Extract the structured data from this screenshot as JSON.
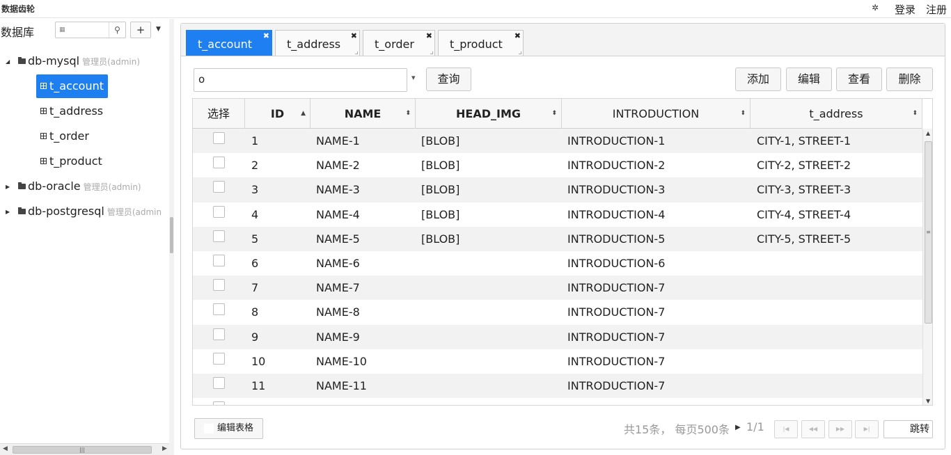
{
  "app": {
    "title": "数据齿轮",
    "settings_icon": "gear-icon",
    "settings_glyph": "✲",
    "login": "登录",
    "register": "注册"
  },
  "sidebar": {
    "title": "数据库",
    "search_placeholder": "",
    "add_label": "+",
    "databases": [
      {
        "name": "db-mysql",
        "role": "管理员(admin)",
        "expanded": true,
        "tables": [
          "t_account",
          "t_address",
          "t_order",
          "t_product"
        ],
        "selected": "t_account"
      },
      {
        "name": "db-oracle",
        "role": "管理员(admin)",
        "expanded": false
      },
      {
        "name": "db-postgresql",
        "role": "管理员(admin",
        "expanded": false
      }
    ]
  },
  "tabs": [
    {
      "label": "t_account",
      "active": true
    },
    {
      "label": "t_address",
      "active": false
    },
    {
      "label": "t_order",
      "active": false
    },
    {
      "label": "t_product",
      "active": false
    }
  ],
  "toolbar": {
    "query_value": "o",
    "query_button": "查询",
    "add_button": "添加",
    "edit_button": "编辑",
    "view_button": "查看",
    "delete_button": "删除"
  },
  "grid": {
    "columns": [
      "选择",
      "ID",
      "NAME",
      "HEAD_IMG",
      "INTRODUCTION",
      "t_address"
    ],
    "sorted_column": "ID",
    "rows": [
      {
        "id": "1",
        "name": "NAME-1",
        "head_img": "[BLOB]",
        "intro": "INTRODUCTION-1",
        "address": "CITY-1, STREET-1"
      },
      {
        "id": "2",
        "name": "NAME-2",
        "head_img": "[BLOB]",
        "intro": "INTRODUCTION-2",
        "address": "CITY-2, STREET-2"
      },
      {
        "id": "3",
        "name": "NAME-3",
        "head_img": "[BLOB]",
        "intro": "INTRODUCTION-3",
        "address": "CITY-3, STREET-3"
      },
      {
        "id": "4",
        "name": "NAME-4",
        "head_img": "[BLOB]",
        "intro": "INTRODUCTION-4",
        "address": "CITY-4, STREET-4"
      },
      {
        "id": "5",
        "name": "NAME-5",
        "head_img": "[BLOB]",
        "intro": "INTRODUCTION-5",
        "address": "CITY-5, STREET-5"
      },
      {
        "id": "6",
        "name": "NAME-6",
        "head_img": "",
        "intro": "INTRODUCTION-6",
        "address": ""
      },
      {
        "id": "7",
        "name": "NAME-7",
        "head_img": "",
        "intro": "INTRODUCTION-7",
        "address": ""
      },
      {
        "id": "8",
        "name": "NAME-8",
        "head_img": "",
        "intro": "INTRODUCTION-7",
        "address": ""
      },
      {
        "id": "9",
        "name": "NAME-9",
        "head_img": "",
        "intro": "INTRODUCTION-7",
        "address": ""
      },
      {
        "id": "10",
        "name": "NAME-10",
        "head_img": "",
        "intro": "INTRODUCTION-7",
        "address": ""
      },
      {
        "id": "11",
        "name": "NAME-11",
        "head_img": "",
        "intro": "INTRODUCTION-7",
        "address": ""
      },
      {
        "id": "",
        "name": "",
        "head_img": "",
        "intro": "",
        "address": ""
      }
    ]
  },
  "footer": {
    "edit_grid_button": "编辑表格",
    "summary": "共15条，  每页500条",
    "page": "1/1",
    "jump_button": "跳转"
  },
  "colors": {
    "accent": "#1e7ff0",
    "muted_text": "#999999",
    "row_stripe": "#f2f2f2"
  }
}
